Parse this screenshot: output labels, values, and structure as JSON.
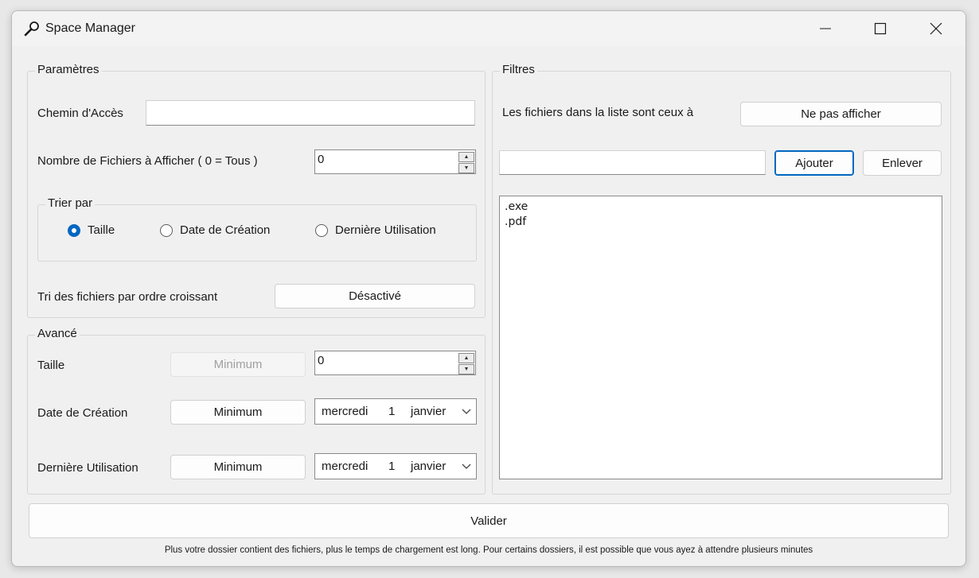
{
  "window": {
    "title": "Space Manager",
    "icon": "magnifier-icon"
  },
  "parametres": {
    "group_label": "Paramètres",
    "path_label": "Chemin d'Accès",
    "path_value": "",
    "count_label": "Nombre de Fichiers à Afficher ( 0 = Tous )",
    "count_value": "0",
    "sort_group_label": "Trier par",
    "sort_options": [
      {
        "label": "Taille",
        "selected": true
      },
      {
        "label": "Date de Création",
        "selected": false
      },
      {
        "label": "Dernière Utilisation",
        "selected": false
      }
    ],
    "order_label": "Tri des fichiers par ordre croissant",
    "order_button": "Désactivé"
  },
  "avance": {
    "group_label": "Avancé",
    "size_label": "Taille",
    "size_button": "Minimum",
    "size_value": "0",
    "creation_label": "Date de Création",
    "creation_button": "Minimum",
    "creation_date": {
      "weekday": "mercredi",
      "day": "1",
      "month": "janvier"
    },
    "last_use_label": "Dernière Utilisation",
    "last_use_button": "Minimum",
    "last_use_date": {
      "weekday": "mercredi",
      "day": "1",
      "month": "janvier"
    }
  },
  "filtres": {
    "group_label": "Filtres",
    "mode_label": "Les fichiers dans la liste sont ceux à",
    "mode_button": "Ne pas afficher",
    "filter_input": "",
    "add_button": "Ajouter",
    "remove_button": "Enlever",
    "items": [
      ".exe",
      ".pdf"
    ]
  },
  "validate_button": "Valider",
  "footer_note": "Plus votre dossier contient des fichiers, plus le temps de chargement est long. Pour certains dossiers, il est possible que vous ayez à attendre plusieurs minutes",
  "colors": {
    "accent": "#0067c0",
    "window_bg": "#f0f0f0"
  }
}
